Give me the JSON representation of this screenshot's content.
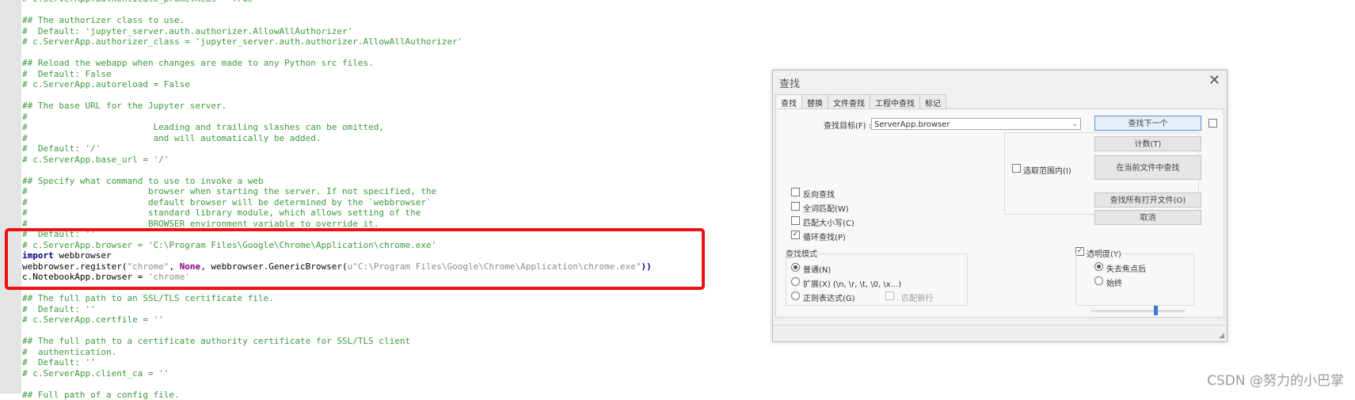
{
  "editor": {
    "lines": [
      [
        {
          "c": "cm",
          "t": "# c.ServerApp.authenticate_prometheus = True"
        }
      ],
      [
        {
          "c": "cm",
          "t": ""
        }
      ],
      [
        {
          "c": "cm",
          "t": "## The authorizer class to use."
        }
      ],
      [
        {
          "c": "cm",
          "t": "#  Default: 'jupyter_server.auth.authorizer.AllowAllAuthorizer'"
        }
      ],
      [
        {
          "c": "cm",
          "t": "# c.ServerApp.authorizer_class = 'jupyter_server.auth.authorizer.AllowAllAuthorizer'"
        }
      ],
      [
        {
          "c": "cm",
          "t": ""
        }
      ],
      [
        {
          "c": "cm",
          "t": "## Reload the webapp when changes are made to any Python src files."
        }
      ],
      [
        {
          "c": "cm",
          "t": "#  Default: False"
        }
      ],
      [
        {
          "c": "cm",
          "t": "# c.ServerApp.autoreload = False"
        }
      ],
      [
        {
          "c": "cm",
          "t": ""
        }
      ],
      [
        {
          "c": "cm",
          "t": "## The base URL for the Jupyter server."
        }
      ],
      [
        {
          "c": "cm",
          "t": "#"
        }
      ],
      [
        {
          "c": "cm",
          "t": "#                        Leading and trailing slashes can be omitted,"
        }
      ],
      [
        {
          "c": "cm",
          "t": "#                        and will automatically be added."
        }
      ],
      [
        {
          "c": "cm",
          "t": "#  Default: '/'"
        }
      ],
      [
        {
          "c": "cm",
          "t": "# c.ServerApp.base_url = '/'"
        }
      ],
      [
        {
          "c": "cm",
          "t": ""
        }
      ],
      [
        {
          "c": "cm",
          "t": "## Specify what command to use to invoke a web"
        }
      ],
      [
        {
          "c": "cm",
          "t": "#                       browser when starting the server. If not specified, the"
        }
      ],
      [
        {
          "c": "cm",
          "t": "#                       default browser will be determined by the `webbrowser`"
        }
      ],
      [
        {
          "c": "cm",
          "t": "#                       standard library module, which allows setting of the"
        }
      ],
      [
        {
          "c": "cm",
          "t": "#                       BROWSER environment variable to override it."
        }
      ],
      [
        {
          "c": "cm",
          "t": "#  Default: ''"
        }
      ],
      [
        {
          "c": "cm",
          "t": "# c.ServerApp.browser = 'C:\\Program Files\\Google\\Chrome\\Application\\chrome.exe'"
        }
      ],
      [
        {
          "c": "kw",
          "t": "import"
        },
        {
          "c": "pl",
          "t": " webbrowser"
        }
      ],
      [
        {
          "c": "pl",
          "t": "webbrowser.register("
        },
        {
          "c": "st",
          "t": "\"chrome\""
        },
        {
          "c": "pl",
          "t": ", "
        },
        {
          "c": "nm",
          "t": "None"
        },
        {
          "c": "pl",
          "t": ", webbrowser.GenericBrowser("
        },
        {
          "c": "st",
          "t": "u\"C:\\Program Files\\Google\\Chrome\\Application\\chrome.exe\""
        },
        {
          "c": "kw",
          "t": "))"
        }
      ],
      [
        {
          "c": "pl",
          "t": "c.NotebookApp.browser = "
        },
        {
          "c": "st",
          "t": "'chrome'"
        }
      ],
      [
        {
          "c": "cm",
          "t": ""
        }
      ],
      [
        {
          "c": "cm",
          "t": "## The full path to an SSL/TLS certificate file."
        }
      ],
      [
        {
          "c": "cm",
          "t": "#  Default: ''"
        }
      ],
      [
        {
          "c": "cm",
          "t": "# c.ServerApp.certfile = ''"
        }
      ],
      [
        {
          "c": "cm",
          "t": ""
        }
      ],
      [
        {
          "c": "cm",
          "t": "## The full path to a certificate authority certificate for SSL/TLS client"
        }
      ],
      [
        {
          "c": "cm",
          "t": "#  authentication."
        }
      ],
      [
        {
          "c": "cm",
          "t": "#  Default: ''"
        }
      ],
      [
        {
          "c": "cm",
          "t": "# c.ServerApp.client_ca = ''"
        }
      ],
      [
        {
          "c": "cm",
          "t": ""
        }
      ],
      [
        {
          "c": "cm",
          "t": "## Full path of a config file."
        }
      ]
    ]
  },
  "dialog": {
    "title": "查找",
    "close": "✕",
    "tabs": [
      "查找",
      "替换",
      "文件查找",
      "工程中查找",
      "标记"
    ],
    "find_label": "查找目标(F) :",
    "find_value": "ServerApp.browser",
    "buttons": {
      "find_next": "查找下一个",
      "count": "计数(T)",
      "find_in_file": "在当前文件中查找",
      "find_all_open": "查找所有打开文件(O)",
      "cancel": "取消"
    },
    "in_selection": "选取范围内(I)",
    "options": {
      "backward": "反向查找",
      "whole_word": "全词匹配(W)",
      "match_case": "匹配大小写(C)",
      "wrap": "循环查找(P)"
    },
    "mode": {
      "title": "查找模式",
      "normal": "普通(N)",
      "extended": "扩展(X) (\\n, \\r, \\t, \\0, \\x...)",
      "regex": "正则表达式(G)",
      "dot_newline": ". 匹配新行"
    },
    "transparency": {
      "title": "透明度(Y)",
      "on_lose_focus": "失去焦点后",
      "always": "始终",
      "level": 0.7
    }
  },
  "watermark": "CSDN @努力的小巴掌"
}
